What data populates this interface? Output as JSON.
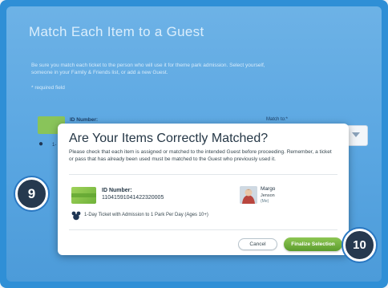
{
  "page": {
    "title": "Match Each Item to a Guest",
    "intro": "Be sure you match each ticket to the person who will use it for theme park admission. Select yourself, someone in your Family & Friends list, or add a new Guest.",
    "required_note": "* required field"
  },
  "background_row": {
    "id_label": "ID Number:",
    "match_label": "Match to:*",
    "ticket_fragment": "1-"
  },
  "modal": {
    "title": "Are Your Items Correctly Matched?",
    "description": "Please check that each item is assigned or matched to the intended Guest before proceeding. Remember, a ticket or pass that has already been used must be matched to the Guest who previously used it.",
    "item": {
      "id_label": "ID Number:",
      "id_value": "11041591041422320005",
      "ticket_description": "1-Day Ticket with Admission to 1 Park Per Day (Ages 10+)"
    },
    "guest": {
      "first_name": "Margo",
      "last_name": "Jenson",
      "role": "(Me)"
    },
    "cancel_label": "Cancel",
    "finalize_label": "Finalize Selection"
  },
  "badges": {
    "step_a": "9",
    "step_b": "10"
  },
  "colors": {
    "frame": "#2f8fd6",
    "panel": "#5ba7e2",
    "badge": "#26394f",
    "finalize": "#6fae38",
    "ticket": "#8ec64a"
  },
  "icons": {
    "mickey": "mickey-icon",
    "ticket": "ticket-icon",
    "dropdown": "chevron-down-icon"
  }
}
